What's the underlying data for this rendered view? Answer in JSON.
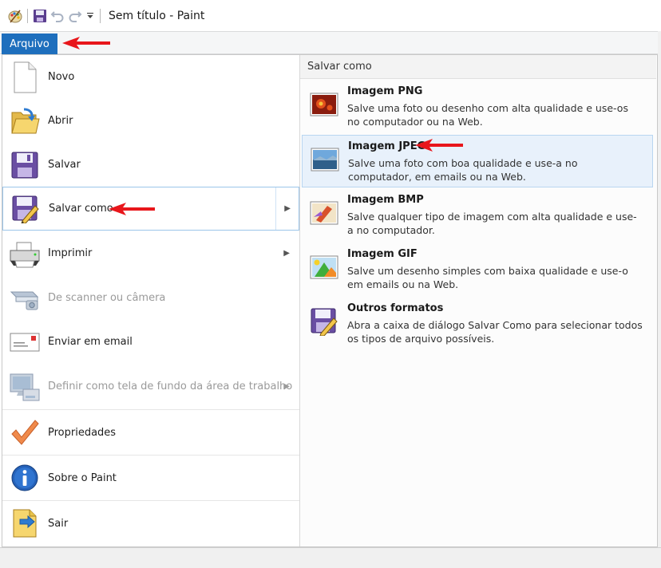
{
  "window": {
    "title": "Sem título - Paint"
  },
  "ribbon": {
    "file_tab": "Arquivo"
  },
  "file_menu": {
    "items": [
      {
        "label": "Novo",
        "icon": "new-document-icon"
      },
      {
        "label": "Abrir",
        "icon": "open-folder-icon"
      },
      {
        "label": "Salvar",
        "icon": "save-disk-icon"
      },
      {
        "label": "Salvar como",
        "icon": "save-as-icon"
      },
      {
        "label": "Imprimir",
        "icon": "printer-icon"
      },
      {
        "label": "De scanner ou câmera",
        "icon": "scanner-icon"
      },
      {
        "label": "Enviar em email",
        "icon": "email-icon"
      },
      {
        "label": "Definir como tela de fundo da área de trabalho",
        "icon": "desktop-icon"
      },
      {
        "label": "Propriedades",
        "icon": "checkmark-icon"
      },
      {
        "label": "Sobre o Paint",
        "icon": "info-icon"
      },
      {
        "label": "Sair",
        "icon": "exit-icon"
      }
    ]
  },
  "save_as_panel": {
    "header": "Salvar como",
    "options": [
      {
        "title": "Imagem PNG",
        "desc": "Salve uma foto ou desenho com alta qualidade e use-os no computador ou na Web.",
        "icon": "png-image-icon"
      },
      {
        "title": "Imagem JPEG",
        "desc": "Salve uma foto com boa qualidade e use-a no computador, em emails ou na Web.",
        "icon": "jpeg-image-icon"
      },
      {
        "title": "Imagem BMP",
        "desc": "Salve qualquer tipo de imagem com alta qualidade e use-a no computador.",
        "icon": "bmp-image-icon"
      },
      {
        "title": "Imagem GIF",
        "desc": "Salve um desenho simples com baixa qualidade e use-o em emails ou na Web.",
        "icon": "gif-image-icon"
      },
      {
        "title": "Outros formatos",
        "desc": "Abra a caixa de diálogo Salvar Como para selecionar todos os tipos de arquivo possíveis.",
        "icon": "other-formats-icon"
      }
    ]
  },
  "colors": {
    "accent": "#1e6fbd",
    "hover_bg": "#e8f1fb",
    "annotation_arrow": "#e8161b"
  }
}
